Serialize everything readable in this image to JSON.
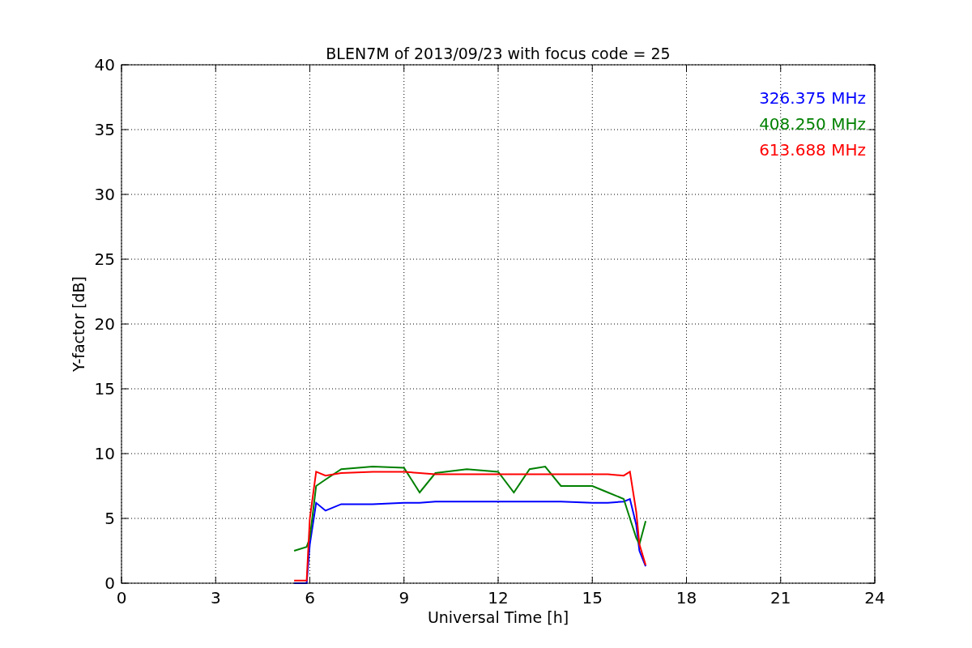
{
  "figure": {
    "chart_data": {
      "type": "line",
      "title": "BLEN7M of 2013/09/23 with focus code = 25",
      "xlabel": "Universal Time [h]",
      "ylabel": "Y-factor [dB]",
      "x": [
        5.5,
        5.9,
        6.0,
        6.2,
        6.5,
        7,
        8,
        9,
        9.5,
        10,
        11,
        12,
        12.5,
        13,
        13.5,
        14,
        15,
        15.5,
        16,
        16.2,
        16.4,
        16.5,
        16.7
      ],
      "series": [
        {
          "name": "326.375 MHz",
          "color": "#0000ff",
          "values": [
            0,
            0,
            3,
            6.2,
            5.6,
            6.1,
            6.1,
            6.2,
            6.2,
            6.3,
            6.3,
            6.3,
            6.3,
            6.3,
            6.3,
            6.3,
            6.2,
            6.2,
            6.3,
            6.5,
            4.5,
            2.5,
            1.3
          ]
        },
        {
          "name": "408.250 MHz",
          "color": "#008000",
          "values": [
            2.5,
            2.8,
            3.5,
            7.5,
            8.0,
            8.8,
            9.0,
            8.9,
            7.0,
            8.5,
            8.8,
            8.6,
            7.0,
            8.8,
            9.0,
            7.5,
            7.5,
            7.0,
            6.5,
            5.0,
            3.5,
            3.0,
            4.8
          ]
        },
        {
          "name": "613.688 MHz",
          "color": "#ff0000",
          "values": [
            0.2,
            0.2,
            5,
            8.6,
            8.3,
            8.5,
            8.6,
            8.6,
            8.5,
            8.4,
            8.4,
            8.4,
            8.4,
            8.4,
            8.4,
            8.4,
            8.4,
            8.4,
            8.3,
            8.6,
            5.5,
            3,
            1.4
          ]
        }
      ],
      "xlim": [
        0,
        24
      ],
      "ylim": [
        0,
        40
      ],
      "xticks": [
        0,
        3,
        6,
        9,
        12,
        15,
        18,
        21,
        24
      ],
      "yticks": [
        0,
        5,
        10,
        15,
        20,
        25,
        30,
        35,
        40
      ],
      "grid": true
    }
  }
}
